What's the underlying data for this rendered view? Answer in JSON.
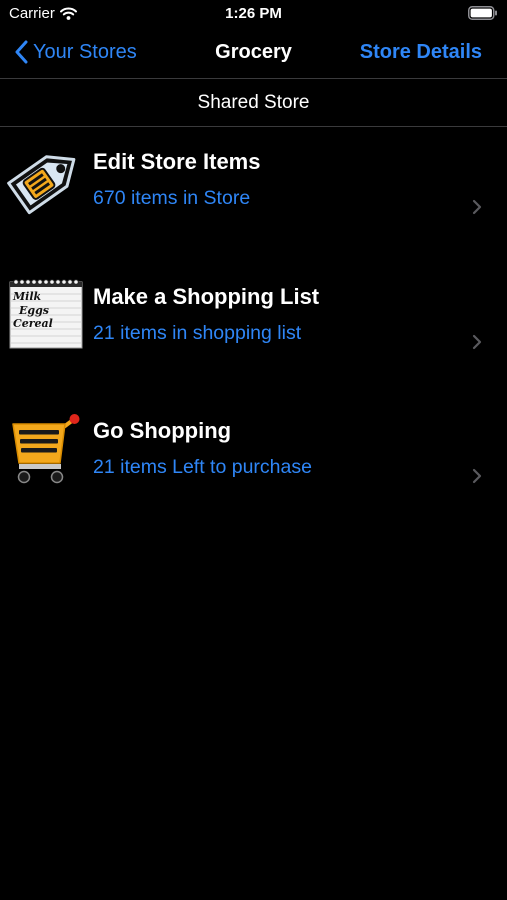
{
  "status_bar": {
    "carrier": "Carrier",
    "time": "1:26 PM"
  },
  "nav": {
    "back_label": "Your Stores",
    "title": "Grocery",
    "right_label": "Store Details"
  },
  "header": {
    "title": "Shared Store"
  },
  "items": [
    {
      "title": "Edit Store Items",
      "subtitle": "670 items in Store",
      "icon": "price-tag-icon"
    },
    {
      "title": "Make a Shopping List",
      "subtitle": "21 items in shopping list",
      "icon": "notepad-icon",
      "icon_text": [
        "Milk",
        "Eggs",
        "Cereal"
      ]
    },
    {
      "title": "Go Shopping",
      "subtitle": "21 items Left to purchase",
      "icon": "shopping-cart-icon"
    }
  ],
  "colors": {
    "background": "#000000",
    "accent": "#2f86f6",
    "text": "#ffffff",
    "separator": "#3a3a3c",
    "chevron": "#5a5a5e"
  }
}
